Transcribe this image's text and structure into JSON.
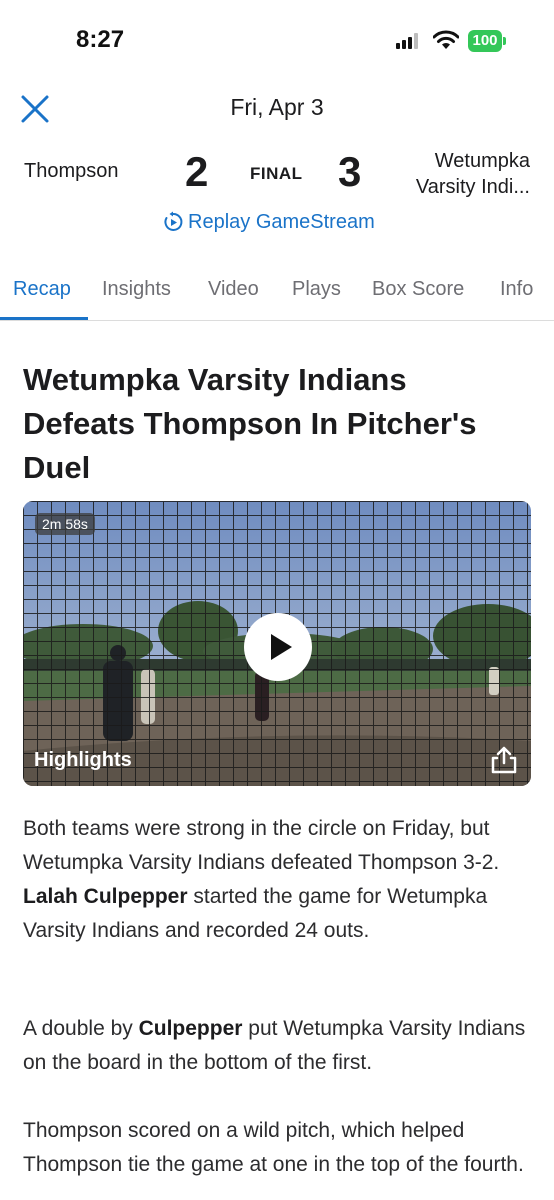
{
  "status_bar": {
    "time": "8:27",
    "battery": "100"
  },
  "header": {
    "date": "Fri, Apr 3"
  },
  "scoreboard": {
    "home_team": "Thompson",
    "home_score": "2",
    "status": "FINAL",
    "away_score": "3",
    "away_team_line1": "Wetumpka",
    "away_team_line2": "Varsity Indi..."
  },
  "replay": {
    "label": "Replay GameStream"
  },
  "tabs": [
    "Recap",
    "Insights",
    "Video",
    "Plays",
    "Box Score",
    "Info"
  ],
  "active_tab": "Recap",
  "article": {
    "headline": "Wetumpka Varsity Indians Defeats Thompson In Pitcher's Duel",
    "video": {
      "duration": "2m 58s",
      "label": "Highlights"
    },
    "p1": {
      "t1": "Both teams were strong in the circle on Friday, but Wetumpka Varsity Indians defeated Thompson 3-2. ",
      "b1": "Lalah Culpepper",
      "t2": " started the game for Wetumpka Varsity Indians and recorded 24 outs."
    },
    "p2": {
      "t1": "A double by ",
      "b1": "Culpepper",
      "t2": " put Wetumpka Varsity Indians on the board in the bottom of the first."
    },
    "p3": {
      "t1": "Thompson scored on a wild pitch, which helped Thompson tie the game at one in the top of the fourth."
    }
  },
  "colors": {
    "accent": "#1a73c8",
    "battery": "#34c759"
  }
}
